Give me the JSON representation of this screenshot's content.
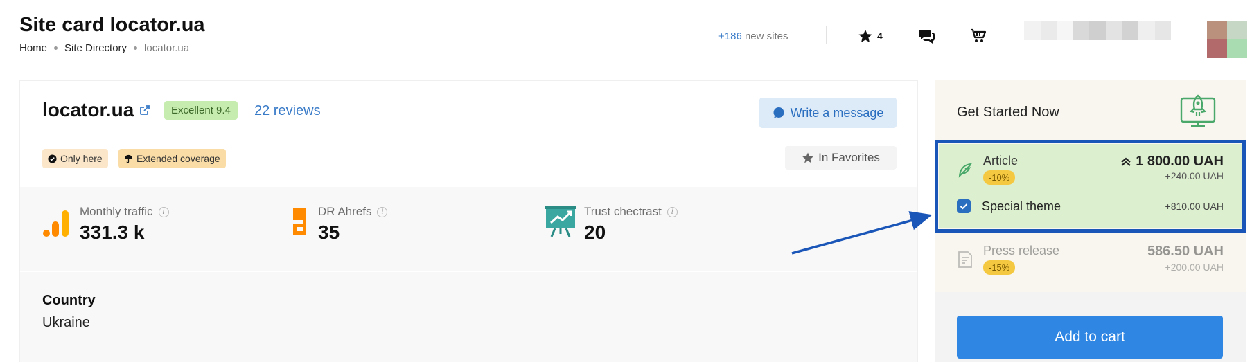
{
  "header": {
    "title": "Site card locator.ua",
    "breadcrumb": {
      "home": "Home",
      "directory": "Site Directory",
      "current": "locator.ua"
    },
    "new_sites_count": "+186",
    "new_sites_label": "new sites",
    "favorites_count": "4"
  },
  "site": {
    "name": "locator.ua",
    "rating": "Excellent 9.4",
    "reviews": "22 reviews",
    "write_message": "Write a message",
    "tags": {
      "only_here": "Only here",
      "extended": "Extended coverage"
    },
    "favorites_button": "In Favorites",
    "metrics": {
      "traffic_label": "Monthly traffic",
      "traffic_value": "331.3 k",
      "dr_label": "DR Ahrefs",
      "dr_value": "35",
      "trust_label": "Trust chectrast",
      "trust_value": "20"
    },
    "country_label": "Country",
    "country_value": "Ukraine"
  },
  "sidebar": {
    "title": "Get Started Now",
    "article": {
      "name": "Article",
      "discount": "-10%",
      "price": "1 800.00 UAH",
      "sub_price": "+240.00 UAH",
      "special_label": "Special theme",
      "special_price": "+810.00 UAH",
      "special_checked": true
    },
    "press": {
      "name": "Press release",
      "discount": "-15%",
      "price": "586.50 UAH",
      "sub_price": "+200.00 UAH"
    },
    "add_to_cart": "Add to cart"
  },
  "colors": {
    "accent": "#2f86e3",
    "link": "#3a7bc8",
    "highlight_border": "#1a55b8",
    "offer_bg": "#dcf0cf",
    "orange": "#ff8a00",
    "teal": "#3aa7a0"
  },
  "icons": [
    "external-link-icon",
    "star-icon",
    "chat-icon",
    "cart-icon",
    "feather-icon",
    "document-icon",
    "rocket-icon",
    "bars-icon",
    "ahrefs-icon",
    "trust-icon"
  ]
}
